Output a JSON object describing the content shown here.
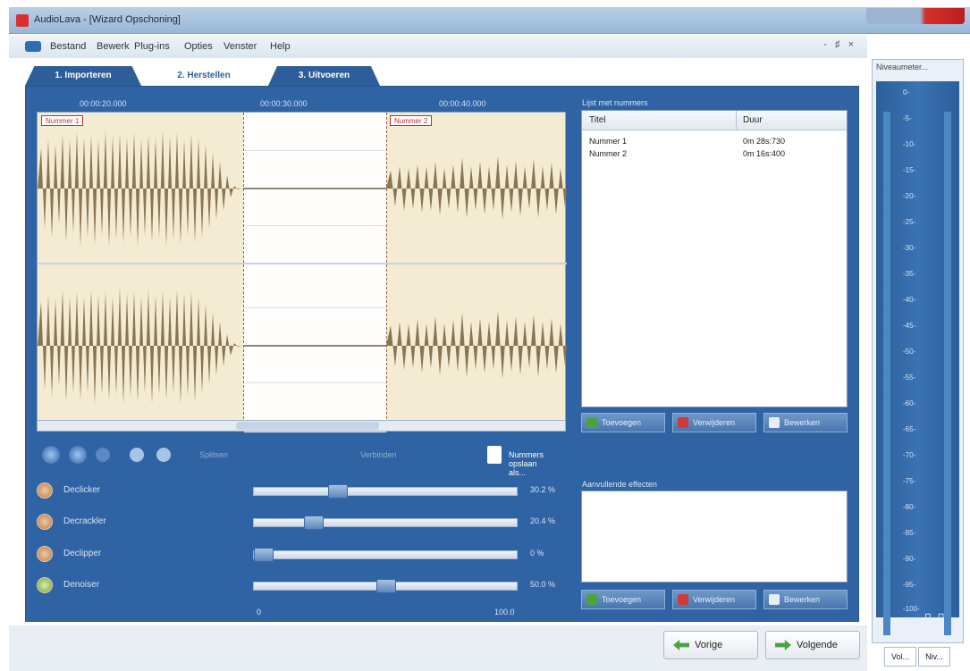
{
  "window": {
    "title": "AudioLava - [Wizard Opschoning]"
  },
  "menu": {
    "items": [
      "Bestand",
      "Bewerk",
      "Plug-ins",
      "Opties",
      "Venster",
      "Help"
    ],
    "mdi_controls": "- ♯ ×"
  },
  "tabs": [
    {
      "label": "1. Importeren",
      "active": false
    },
    {
      "label": "2. Herstellen",
      "active": true
    },
    {
      "label": "3. Uitvoeren",
      "active": false
    }
  ],
  "timeline": {
    "ticks": [
      "00:00:20.000",
      "00:00:30.000",
      "00:00:40.000"
    ]
  },
  "waveform": {
    "track_labels": [
      "Nummer 1",
      "Nummer 2"
    ]
  },
  "tracklist": {
    "label": "Lijst met nummers",
    "columns": [
      "Titel",
      "Duur"
    ],
    "rows": [
      {
        "title": "Nummer 1",
        "duration": "0m 28s:730"
      },
      {
        "title": "Nummer 2",
        "duration": "0m 16s:400"
      }
    ],
    "buttons": {
      "add": "Toevoegen",
      "remove": "Verwijderen",
      "edit": "Bewerken"
    }
  },
  "toolbar": {
    "split_label": "Splitsen",
    "merge_label": "Verbinden",
    "save_tracks_label": "Nummers opslaan als..."
  },
  "effects": [
    {
      "label": "Declicker",
      "value_text": "30.2 %",
      "fraction": 0.302,
      "knob": "orange"
    },
    {
      "label": "Decrackler",
      "value_text": "20.4 %",
      "fraction": 0.204,
      "knob": "orange"
    },
    {
      "label": "Declipper",
      "value_text": "0 %",
      "fraction": 0.0,
      "knob": "orange"
    },
    {
      "label": "Denoiser",
      "value_text": "50.0 %",
      "fraction": 0.5,
      "knob": "green"
    }
  ],
  "scale": {
    "min": "0",
    "max": "100.0"
  },
  "extra_effects": {
    "label": "Aanvullende effecten",
    "buttons": {
      "add": "Toevoegen",
      "remove": "Verwijderen",
      "edit": "Bewerken"
    }
  },
  "navigation": {
    "prev": "Vorige",
    "next": "Volgende"
  },
  "meter": {
    "title": "Niveaumeter...",
    "ticks": [
      "0-",
      "-5-",
      "-10-",
      "-15-",
      "-20-",
      "-25-",
      "-30-",
      "-35-",
      "-40-",
      "-45-",
      "-50-",
      "-55-",
      "-60-",
      "-65-",
      "-70-",
      "-75-",
      "-80-",
      "-85-",
      "-90-",
      "-95-",
      "-100-"
    ],
    "buttons": "⊓ ⊓",
    "tabs": [
      "Vol...",
      "Niv..."
    ]
  }
}
